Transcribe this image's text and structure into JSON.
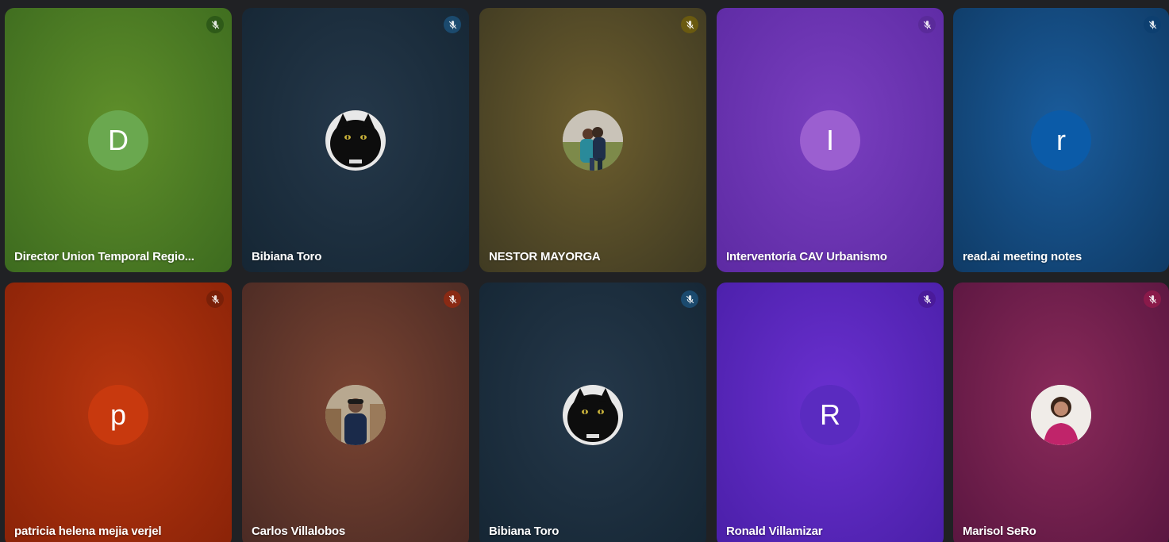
{
  "participants": [
    {
      "name": "Director Union Temporal Regio...",
      "initial": "D",
      "avatar_type": "initial",
      "avatar_color": "#6aa84f",
      "bg_center": "#5f8f2a",
      "bg_edge": "#3d6b1f",
      "mic_color": "#2e5a18",
      "mic_icon": "mic-off-icon"
    },
    {
      "name": "Bibiana Toro",
      "initial": "",
      "avatar_type": "photo-black-cat",
      "avatar_color": "#111111",
      "bg_center": "#25384a",
      "bg_edge": "#152634",
      "mic_color": "#1b4a6e",
      "mic_icon": "mic-off-icon"
    },
    {
      "name": "NESTOR MAYORGA",
      "initial": "",
      "avatar_type": "photo-couple-outdoors",
      "avatar_color": "#8a9a7a",
      "bg_center": "#6d5e2e",
      "bg_edge": "#3f3a22",
      "mic_color": "#6a5a10",
      "mic_icon": "mic-off-icon"
    },
    {
      "name": "Interventoría CAV Urbanismo",
      "initial": "I",
      "avatar_type": "initial",
      "avatar_color": "#9b5fd0",
      "bg_center": "#7a3fc0",
      "bg_edge": "#5d2aa3",
      "mic_color": "#5a2a9a",
      "mic_icon": "mic-off-icon"
    },
    {
      "name": "read.ai meeting notes",
      "initial": "r",
      "avatar_type": "initial",
      "avatar_color": "#0b5ba8",
      "bg_center": "#1a5c9c",
      "bg_edge": "#0f3b66",
      "mic_color": "#0d3f70",
      "mic_icon": "mic-off-icon"
    },
    {
      "name": "patricia helena mejia verjel",
      "initial": "p",
      "avatar_type": "initial",
      "avatar_color": "#c8390e",
      "bg_center": "#b8360f",
      "bg_edge": "#8a2308",
      "mic_color": "#7a2008",
      "mic_icon": "mic-off-icon"
    },
    {
      "name": "Carlos Villalobos",
      "initial": "",
      "avatar_type": "photo-man-city",
      "avatar_color": "#8a7a6a",
      "bg_center": "#7a4432",
      "bg_edge": "#4a2a24",
      "mic_color": "#8a2a14",
      "mic_icon": "mic-off-icon"
    },
    {
      "name": "Bibiana Toro",
      "initial": "",
      "avatar_type": "photo-black-cat",
      "avatar_color": "#111111",
      "bg_center": "#25384a",
      "bg_edge": "#152634",
      "mic_color": "#1b4a6e",
      "mic_icon": "mic-off-icon"
    },
    {
      "name": "Ronald Villamizar",
      "initial": "R",
      "avatar_type": "initial",
      "avatar_color": "#5a2bc0",
      "bg_center": "#6a30d0",
      "bg_edge": "#4a1fa8",
      "mic_color": "#4a1a9a",
      "mic_icon": "mic-off-icon"
    },
    {
      "name": "Marisol SeRo",
      "initial": "",
      "avatar_type": "photo-woman-pink",
      "avatar_color": "#d8c8c0",
      "bg_center": "#8a2a5a",
      "bg_edge": "#5a1640",
      "mic_color": "#8a1a4a",
      "mic_icon": "mic-off-icon"
    }
  ]
}
